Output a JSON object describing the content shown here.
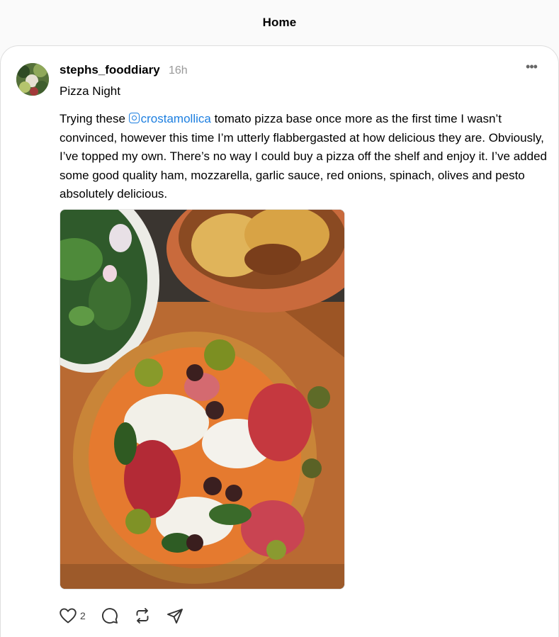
{
  "header": {
    "title": "Home"
  },
  "post": {
    "username": "stephs_fooddiary",
    "time": "16h",
    "more_label": "•••",
    "headline": "Pizza Night",
    "body_before": "Trying these ",
    "mention": "crostamollica",
    "body_after": " tomato pizza base once more as the first time I wasn’t convinced, however this time I’m utterly flabbergasted at how delicious they are. Obviously, I’ve topped my own. There’s no way I could buy a pizza off the shelf and enjoy it. I’ve added some good quality ham, mozzarella, garlic sauce, red onions, spinach, olives and pesto absolutely delicious.",
    "likes": "2"
  },
  "icons": {
    "more": "more-icon",
    "like": "heart-icon",
    "reply": "comment-icon",
    "repost": "repost-icon",
    "share": "send-icon",
    "mention_badge": "instagram-icon"
  },
  "colors": {
    "mention": "#1d7fe0",
    "timestamp": "#999999"
  }
}
